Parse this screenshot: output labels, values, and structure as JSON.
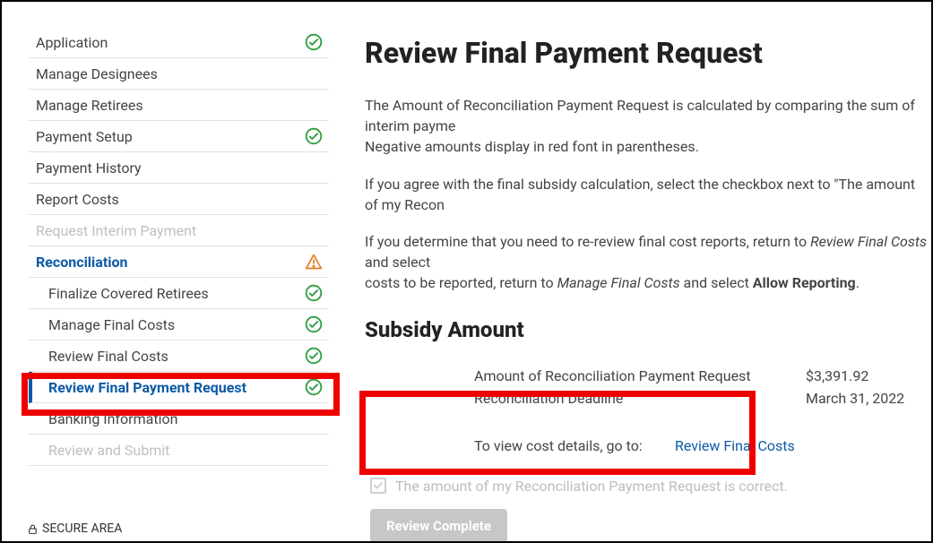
{
  "sidebar": {
    "items": [
      {
        "label": "Application",
        "status": "check"
      },
      {
        "label": "Manage Designees",
        "status": "none"
      },
      {
        "label": "Manage Retirees",
        "status": "none"
      },
      {
        "label": "Payment Setup",
        "status": "check"
      },
      {
        "label": "Payment History",
        "status": "none"
      },
      {
        "label": "Report Costs",
        "status": "none"
      },
      {
        "label": "Request Interim Payment",
        "status": "none"
      },
      {
        "label": "Reconciliation",
        "status": "warn"
      },
      {
        "label": "Finalize Covered Retirees",
        "status": "check"
      },
      {
        "label": "Manage Final Costs",
        "status": "check"
      },
      {
        "label": "Review Final Costs",
        "status": "check"
      },
      {
        "label": "Review Final Payment Request",
        "status": "check"
      },
      {
        "label": "Banking Information",
        "status": "none"
      },
      {
        "label": "Review and Submit",
        "status": "none"
      }
    ]
  },
  "main": {
    "title": "Review Final Payment Request",
    "para1a": "The Amount of Reconciliation Payment Request is calculated by comparing the sum of interim payme",
    "para1b": "Negative amounts display in red font in parentheses.",
    "para2": "If you agree with the final subsidy calculation, select the checkbox next to \"The amount of my Recon",
    "para3a": "If you determine that you need to re-review final cost reports, return to ",
    "para3b": "Review Final Costs",
    "para3c": " and select ",
    "para3d": "costs to be reported, return to ",
    "para3e": "Manage Final Costs",
    "para3f": " and select ",
    "para3g": "Allow Reporting",
    "para3h": ".",
    "subsidy_heading": "Subsidy Amount",
    "row1_label": "Amount of Reconciliation Payment Request",
    "row1_value": "$3,391.92",
    "row2_label": "Reconciliation Deadline",
    "row2_value": "March 31, 2022",
    "cost_label": "To view cost details, go to:",
    "cost_link": "Review Final Costs",
    "checkbox_label": "The amount of my Reconciliation Payment Request is correct.",
    "button_label": "Review Complete"
  },
  "footer": {
    "secure": "SECURE AREA"
  }
}
